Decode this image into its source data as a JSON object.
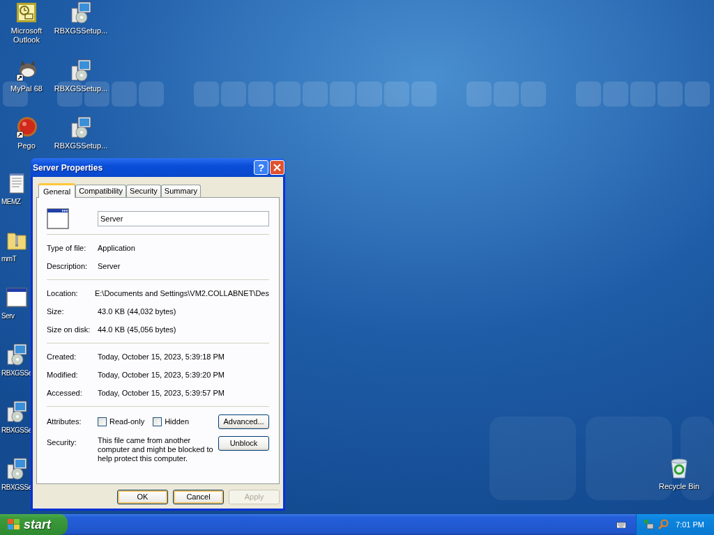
{
  "desktop": {
    "icons": [
      {
        "label": "Microsoft Outlook",
        "kind": "outlook"
      },
      {
        "label": "RBXGSSetup...",
        "kind": "setup"
      },
      {
        "label": "MyPal 68",
        "kind": "mypal"
      },
      {
        "label": "RBXGSSetup...",
        "kind": "setup"
      },
      {
        "label": "Pego",
        "kind": "pego"
      },
      {
        "label": "RBXGSSetup...",
        "kind": "setup"
      },
      {
        "label": "MEMZ",
        "kind": "notepad"
      },
      {
        "label": "mmT",
        "kind": "zip"
      },
      {
        "label": "Serv",
        "kind": "window"
      },
      {
        "label": "RBXGSSe",
        "kind": "setup"
      },
      {
        "label": "RBXGSSe",
        "kind": "setup"
      },
      {
        "label": "RBXGSSe",
        "kind": "setup"
      },
      {
        "label": "Recycle Bin",
        "kind": "recycle"
      }
    ]
  },
  "dialog": {
    "title": "Server Properties",
    "help_button": "?",
    "tabs": [
      {
        "label": "General",
        "selected": true
      },
      {
        "label": "Compatibility",
        "selected": false
      },
      {
        "label": "Security",
        "selected": false
      },
      {
        "label": "Summary",
        "selected": false
      }
    ],
    "file_name": "Server",
    "sections": [
      [
        {
          "label": "Type of file:",
          "value": "Application"
        },
        {
          "label": "Description:",
          "value": "Server"
        }
      ],
      [
        {
          "label": "Location:",
          "value": "E:\\Documents and Settings\\VM2.COLLABNET\\Des"
        },
        {
          "label": "Size:",
          "value": "43.0 KB (44,032 bytes)"
        },
        {
          "label": "Size on disk:",
          "value": "44.0 KB (45,056 bytes)"
        }
      ],
      [
        {
          "label": "Created:",
          "value": "Today, October 15, 2023, 5:39:18 PM"
        },
        {
          "label": "Modified:",
          "value": "Today, October 15, 2023, 5:39:20 PM"
        },
        {
          "label": "Accessed:",
          "value": "Today, October 15, 2023, 5:39:57 PM"
        }
      ]
    ],
    "attributes": {
      "label": "Attributes:",
      "checkboxes": [
        {
          "label": "Read-only",
          "checked": false
        },
        {
          "label": "Hidden",
          "checked": false
        }
      ],
      "button": "Advanced..."
    },
    "security": {
      "label": "Security:",
      "text": "This file came from another computer and might be blocked to help protect this computer.",
      "button": "Unblock"
    },
    "buttons": [
      {
        "label": "OK",
        "disabled": false
      },
      {
        "label": "Cancel",
        "disabled": false
      },
      {
        "label": "Apply",
        "disabled": true
      }
    ]
  },
  "taskbar": {
    "start": "start",
    "clock": "7:01 PM"
  }
}
